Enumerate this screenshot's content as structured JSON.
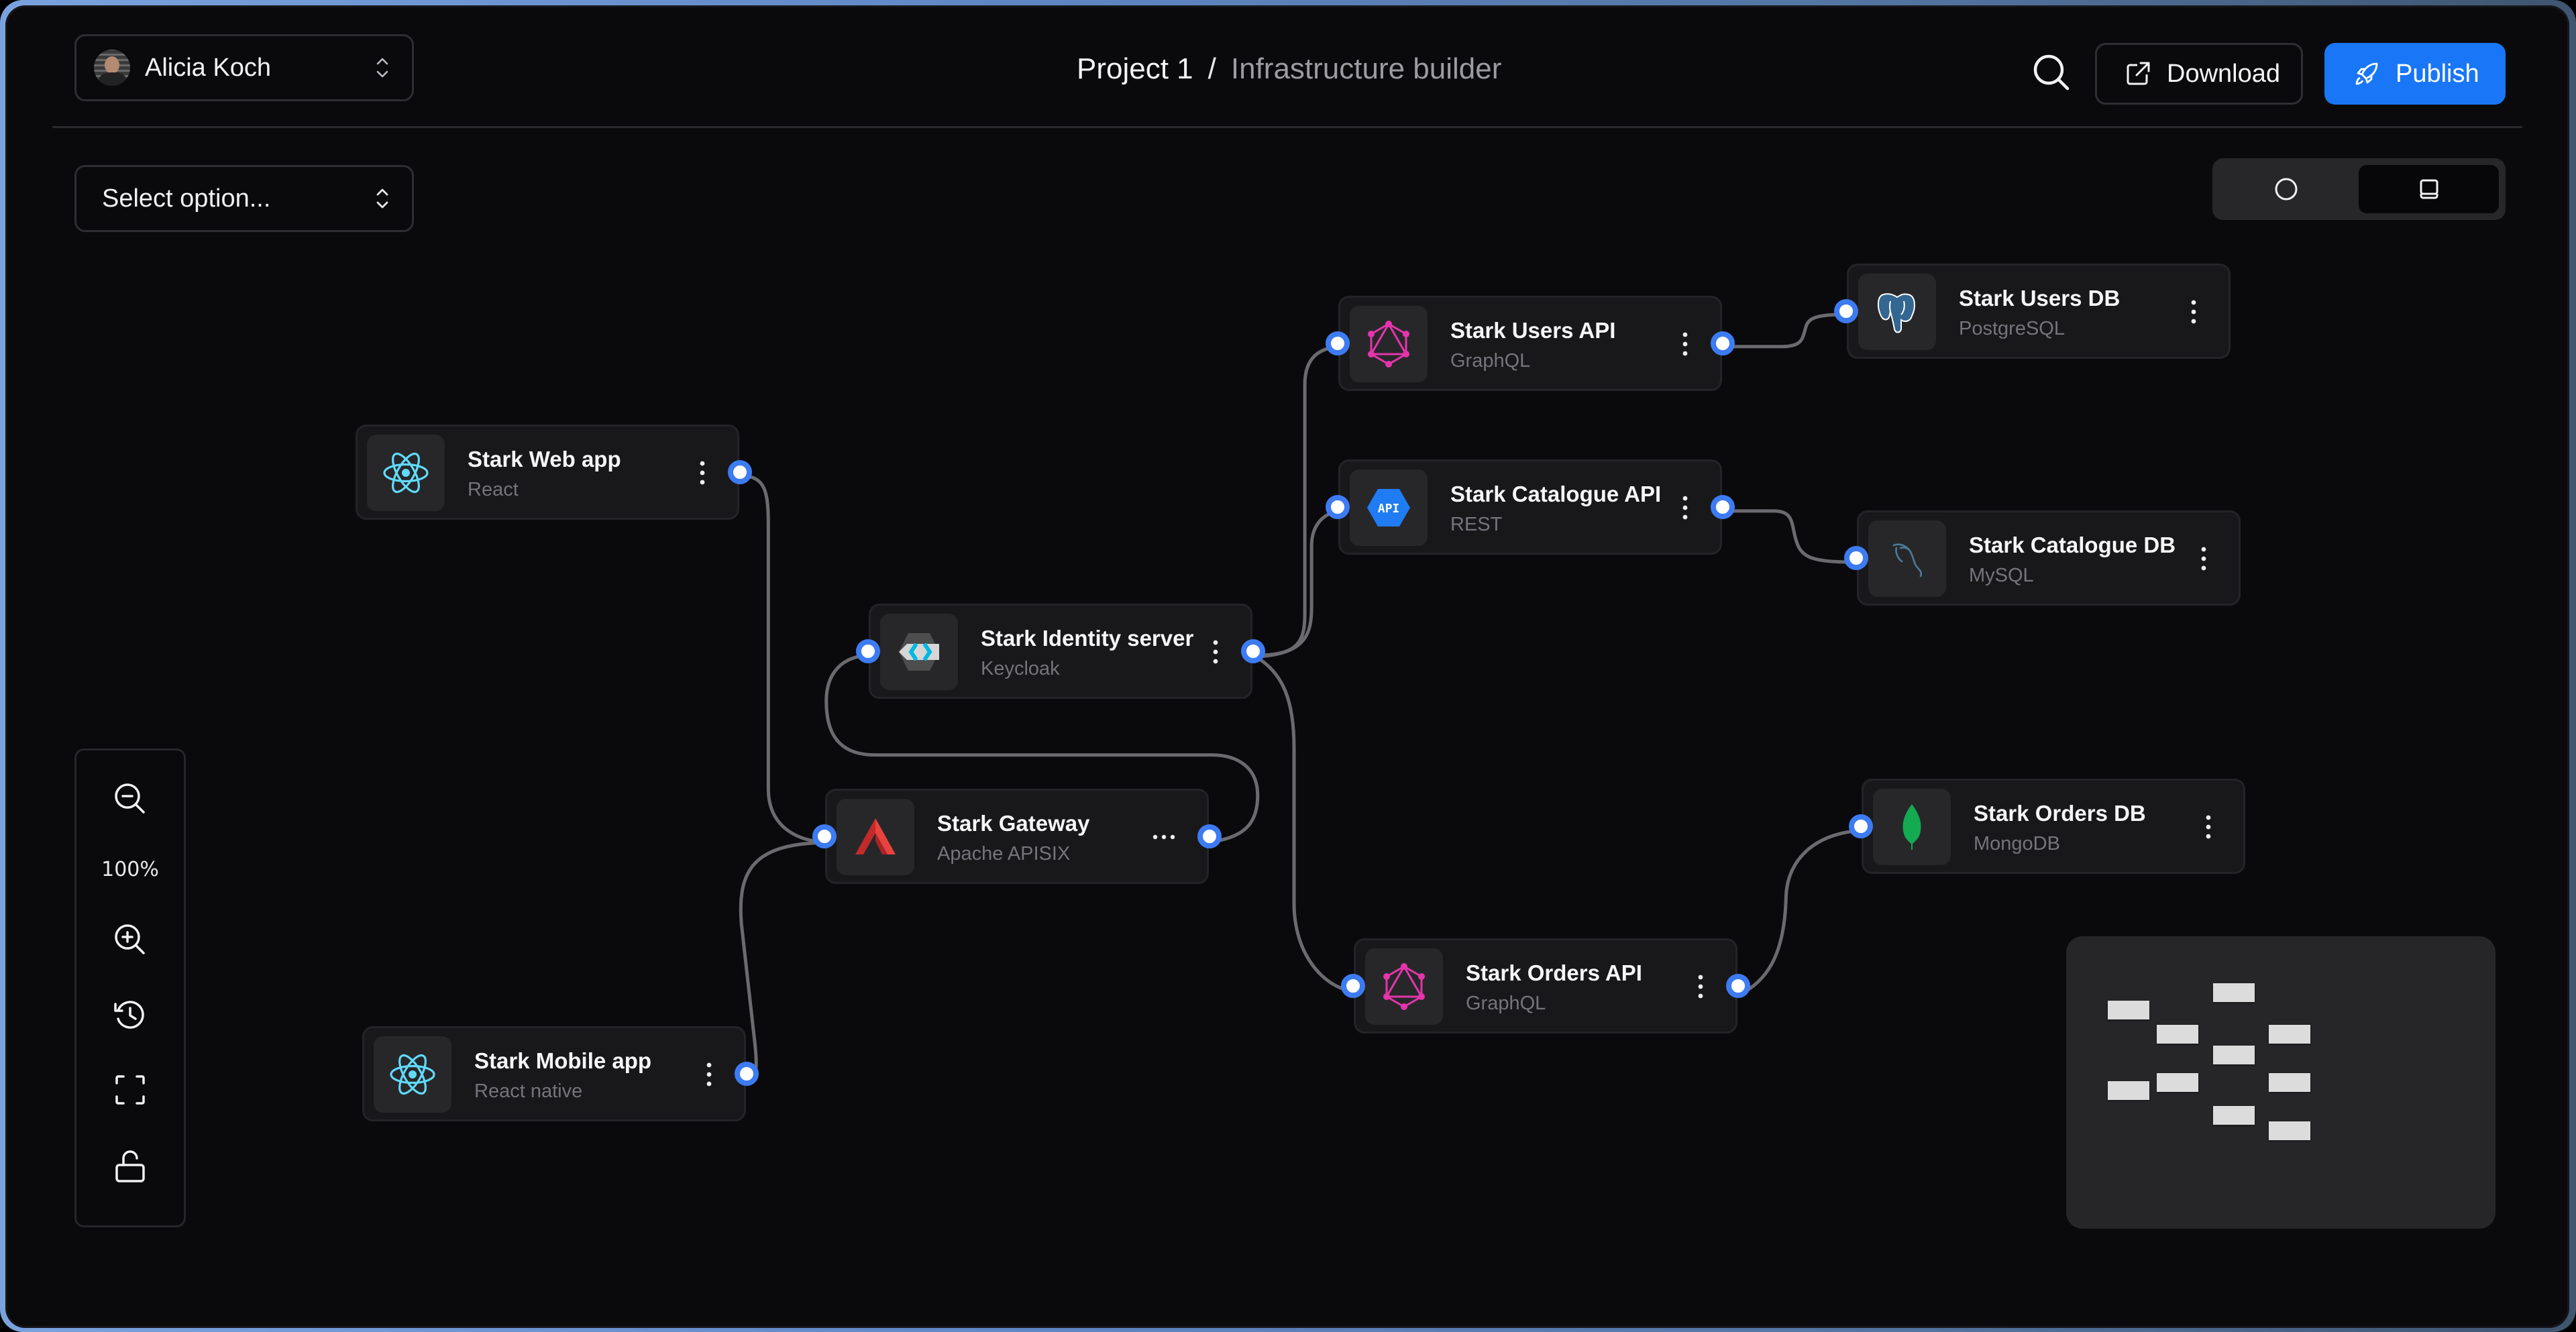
{
  "header": {
    "user_select": {
      "label": "Alicia Koch",
      "icon": "chevron-up-down-icon"
    },
    "breadcrumb": {
      "project": "Project 1",
      "separator": "/",
      "page": "Infrastructure builder"
    },
    "search_icon": "search-icon",
    "download_button": {
      "label": "Download",
      "icon": "external-link-icon"
    },
    "publish_button": {
      "label": "Publish",
      "icon": "rocket-icon"
    },
    "accent_color": "#1976f6"
  },
  "toolbar": {
    "option_select": {
      "label": "Select option...",
      "icon": "chevron-up-down-icon"
    },
    "view_toggle": {
      "options": [
        {
          "icon": "circle-icon",
          "selected": false
        },
        {
          "icon": "laptop-icon",
          "selected": true
        }
      ]
    }
  },
  "zoom_controls": {
    "zoom_out_icon": "zoom-out-icon",
    "zoom_level": "100%",
    "zoom_in_icon": "zoom-in-icon",
    "history_icon": "history-icon",
    "fit_view_icon": "fit-view-icon",
    "lock_icon": "unlock-icon"
  },
  "nodes": [
    {
      "id": "webapp",
      "title": "Stark Web app",
      "subtitle": "React",
      "icon": "react-icon"
    },
    {
      "id": "mobileapp",
      "title": "Stark Mobile app",
      "subtitle": "React native",
      "icon": "react-icon"
    },
    {
      "id": "identity",
      "title": "Stark Identity server",
      "subtitle": "Keycloak",
      "icon": "keycloak-icon"
    },
    {
      "id": "gateway",
      "title": "Stark Gateway",
      "subtitle": "Apache APISIX",
      "icon": "apisix-icon"
    },
    {
      "id": "usersapi",
      "title": "Stark Users API",
      "subtitle": "GraphQL",
      "icon": "graphql-icon"
    },
    {
      "id": "catalogueapi",
      "title": "Stark Catalogue API",
      "subtitle": "REST",
      "icon": "rest-api-icon"
    },
    {
      "id": "ordersapi",
      "title": "Stark Orders API",
      "subtitle": "GraphQL",
      "icon": "graphql-icon"
    },
    {
      "id": "usersdb",
      "title": "Stark Users DB",
      "subtitle": "PostgreSQL",
      "icon": "postgresql-icon"
    },
    {
      "id": "cataloguedb",
      "title": "Stark Catalogue DB",
      "subtitle": "MySQL",
      "icon": "mysql-icon"
    },
    {
      "id": "ordersdb",
      "title": "Stark Orders DB",
      "subtitle": "MongoDB",
      "icon": "mongodb-icon"
    }
  ],
  "edges": [
    {
      "from": "webapp",
      "to": "gateway"
    },
    {
      "from": "mobileapp",
      "to": "gateway"
    },
    {
      "from": "gateway",
      "to": "identity"
    },
    {
      "from": "identity",
      "to": "usersapi"
    },
    {
      "from": "identity",
      "to": "catalogueapi"
    },
    {
      "from": "identity",
      "to": "ordersapi"
    },
    {
      "from": "usersapi",
      "to": "usersdb"
    },
    {
      "from": "catalogueapi",
      "to": "cataloguedb"
    },
    {
      "from": "ordersapi",
      "to": "ordersdb"
    }
  ],
  "colors": {
    "handle": "#3d7bf3",
    "edge": "#6b6b6f",
    "node_bg": "#18181b"
  }
}
